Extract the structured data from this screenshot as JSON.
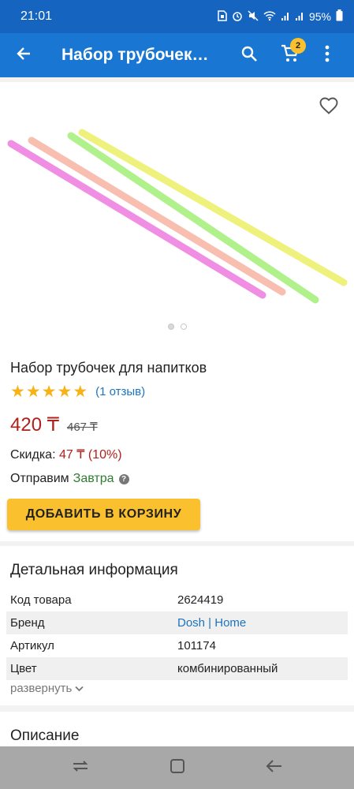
{
  "status_bar": {
    "time": "21:01",
    "battery": "95%",
    "icons": [
      "sim-card-icon",
      "alarm-icon",
      "mute-icon",
      "wifi-icon",
      "signal-icon",
      "signal-icon"
    ]
  },
  "app_bar": {
    "title": "Набор трубочек…",
    "back_icon": "arrow-left-icon",
    "search_icon": "search-icon",
    "cart_icon": "cart-icon",
    "cart_count": "2",
    "menu_icon": "more-vert-icon"
  },
  "product": {
    "favorite_icon": "heart-outline-icon",
    "gallery_pages": 2,
    "gallery_active": 0,
    "straw_colors": [
      "#ee82e0",
      "#f8b8a8",
      "#a8f080",
      "#eef070"
    ],
    "name": "Набор трубочек для напитков",
    "rating_stars": 5,
    "reviews": "(1 отзыв)",
    "price": "420 ₸",
    "old_price": "467 ₸",
    "discount_label": "Скидка:",
    "discount_value": "47 ₸ (10%)",
    "ship_label": "Отправим",
    "ship_when": "Завтра",
    "add_to_cart": "ДОБАВИТЬ В КОРЗИНУ"
  },
  "details": {
    "title": "Детальная информация",
    "rows": [
      {
        "key": "Код товара",
        "value": "2624419"
      },
      {
        "key": "Бренд",
        "value": "Dosh | Home"
      },
      {
        "key": "Артикул",
        "value": "101174"
      },
      {
        "key": "Цвет",
        "value": "комбинированный"
      }
    ],
    "expand": "развернуть"
  },
  "description": {
    "title": "Описание"
  },
  "colors": {
    "statusbar": "#1565c0",
    "appbar": "#1976d2",
    "accent_yellow": "#fbc02d",
    "price_red": "#b0211b",
    "link_blue": "#1e73be",
    "green": "#2e7d32"
  }
}
